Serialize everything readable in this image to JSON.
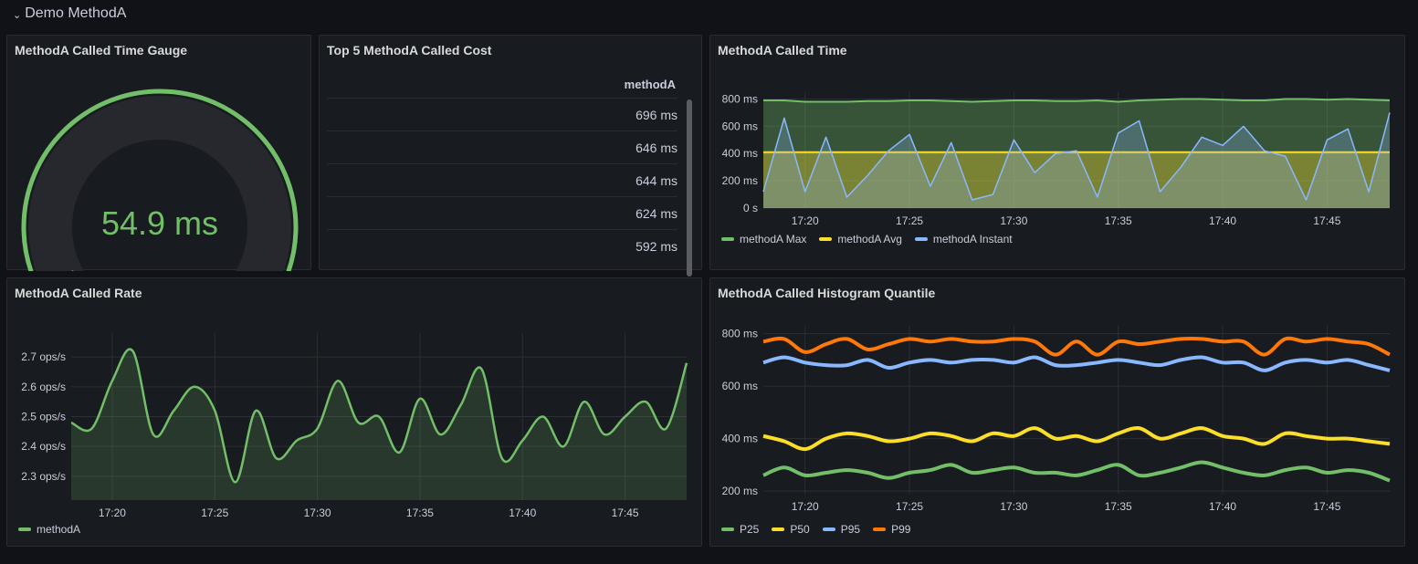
{
  "row": {
    "title": "Demo MethodA"
  },
  "colors": {
    "green": "#73bf69",
    "yellow": "#fade2a",
    "blue": "#8ab8ff",
    "orange": "#ff780a",
    "grid": "#2c2f35",
    "axis": "#ccccdc"
  },
  "gauge_panel": {
    "title": "MethodA Called Time Gauge",
    "value": "54.9 ms",
    "fraction": 0.069
  },
  "top5_panel": {
    "title": "Top 5 MethodA Called Cost",
    "column": "methodA",
    "rows": [
      "696 ms",
      "646 ms",
      "644 ms",
      "624 ms",
      "592 ms"
    ]
  },
  "time_panel": {
    "title": "MethodA Called Time",
    "legend": [
      {
        "label": "methodA Max",
        "color": "#73bf69"
      },
      {
        "label": "methodA Avg",
        "color": "#fade2a"
      },
      {
        "label": "methodA Instant",
        "color": "#8ab8ff"
      }
    ]
  },
  "rate_panel": {
    "title": "MethodA Called Rate",
    "legend": [
      {
        "label": "methodA",
        "color": "#73bf69"
      }
    ]
  },
  "hist_panel": {
    "title": "MethodA Called Histogram Quantile",
    "legend": [
      {
        "label": "P25",
        "color": "#73bf69"
      },
      {
        "label": "P50",
        "color": "#fade2a"
      },
      {
        "label": "P95",
        "color": "#8ab8ff"
      },
      {
        "label": "P99",
        "color": "#ff780a"
      }
    ]
  },
  "chart_data": [
    {
      "id": "time",
      "type": "area",
      "x": [
        "17:18",
        "17:19",
        "17:20",
        "17:21",
        "17:22",
        "17:23",
        "17:24",
        "17:25",
        "17:26",
        "17:27",
        "17:28",
        "17:29",
        "17:30",
        "17:31",
        "17:32",
        "17:33",
        "17:34",
        "17:35",
        "17:36",
        "17:37",
        "17:38",
        "17:39",
        "17:40",
        "17:41",
        "17:42",
        "17:43",
        "17:44",
        "17:45",
        "17:46",
        "17:47",
        "17:48"
      ],
      "xticks": [
        "17:20",
        "17:25",
        "17:30",
        "17:35",
        "17:40",
        "17:45"
      ],
      "yticks": [
        "0 s",
        "200 ms",
        "400 ms",
        "600 ms",
        "800 ms"
      ],
      "ylim": [
        0,
        850
      ],
      "series": [
        {
          "name": "methodA Max",
          "values": [
            790,
            790,
            780,
            780,
            780,
            785,
            785,
            790,
            790,
            785,
            780,
            785,
            790,
            790,
            785,
            785,
            790,
            780,
            790,
            795,
            800,
            800,
            795,
            790,
            790,
            800,
            800,
            795,
            800,
            795,
            790
          ]
        },
        {
          "name": "methodA Avg",
          "values": [
            410,
            410,
            410,
            410,
            410,
            410,
            410,
            410,
            410,
            410,
            410,
            410,
            410,
            410,
            410,
            410,
            410,
            410,
            410,
            410,
            410,
            410,
            410,
            410,
            410,
            410,
            410,
            410,
            410,
            410,
            410
          ]
        },
        {
          "name": "methodA Instant",
          "values": [
            120,
            660,
            120,
            520,
            80,
            240,
            420,
            540,
            160,
            480,
            60,
            100,
            500,
            260,
            400,
            420,
            80,
            550,
            640,
            120,
            300,
            520,
            460,
            600,
            420,
            380,
            60,
            500,
            580,
            120,
            700
          ]
        }
      ]
    },
    {
      "id": "rate",
      "type": "line",
      "x": [
        "17:18",
        "17:19",
        "17:20",
        "17:21",
        "17:22",
        "17:23",
        "17:24",
        "17:25",
        "17:26",
        "17:27",
        "17:28",
        "17:29",
        "17:30",
        "17:31",
        "17:32",
        "17:33",
        "17:34",
        "17:35",
        "17:36",
        "17:37",
        "17:38",
        "17:39",
        "17:40",
        "17:41",
        "17:42",
        "17:43",
        "17:44",
        "17:45",
        "17:46",
        "17:47",
        "17:48"
      ],
      "xticks": [
        "17:20",
        "17:25",
        "17:30",
        "17:35",
        "17:40",
        "17:45"
      ],
      "yticks": [
        "2.3 ops/s",
        "2.4 ops/s",
        "2.5 ops/s",
        "2.6 ops/s",
        "2.7 ops/s"
      ],
      "ylim": [
        2.22,
        2.78
      ],
      "series": [
        {
          "name": "methodA",
          "values": [
            2.48,
            2.46,
            2.62,
            2.72,
            2.44,
            2.52,
            2.6,
            2.52,
            2.28,
            2.52,
            2.36,
            2.42,
            2.46,
            2.62,
            2.48,
            2.5,
            2.38,
            2.56,
            2.44,
            2.54,
            2.66,
            2.36,
            2.42,
            2.5,
            2.4,
            2.55,
            2.44,
            2.5,
            2.55,
            2.46,
            2.68
          ]
        }
      ]
    },
    {
      "id": "hist",
      "type": "line",
      "x": [
        "17:18",
        "17:19",
        "17:20",
        "17:21",
        "17:22",
        "17:23",
        "17:24",
        "17:25",
        "17:26",
        "17:27",
        "17:28",
        "17:29",
        "17:30",
        "17:31",
        "17:32",
        "17:33",
        "17:34",
        "17:35",
        "17:36",
        "17:37",
        "17:38",
        "17:39",
        "17:40",
        "17:41",
        "17:42",
        "17:43",
        "17:44",
        "17:45",
        "17:46",
        "17:47",
        "17:48"
      ],
      "xticks": [
        "17:20",
        "17:25",
        "17:30",
        "17:35",
        "17:40",
        "17:45"
      ],
      "yticks": [
        "200 ms",
        "400 ms",
        "600 ms",
        "800 ms"
      ],
      "ylim": [
        190,
        830
      ],
      "series": [
        {
          "name": "P25",
          "values": [
            260,
            290,
            260,
            270,
            280,
            270,
            250,
            270,
            280,
            300,
            270,
            280,
            290,
            270,
            270,
            260,
            280,
            300,
            260,
            270,
            290,
            310,
            290,
            270,
            260,
            280,
            290,
            270,
            280,
            270,
            240
          ]
        },
        {
          "name": "P50",
          "values": [
            410,
            390,
            360,
            400,
            420,
            410,
            390,
            400,
            420,
            410,
            390,
            420,
            410,
            440,
            400,
            410,
            390,
            420,
            440,
            400,
            420,
            440,
            410,
            400,
            380,
            420,
            410,
            400,
            400,
            390,
            380
          ]
        },
        {
          "name": "P95",
          "values": [
            690,
            710,
            690,
            680,
            680,
            700,
            670,
            690,
            700,
            690,
            700,
            700,
            690,
            710,
            680,
            680,
            690,
            700,
            690,
            680,
            700,
            710,
            690,
            690,
            660,
            690,
            700,
            690,
            700,
            680,
            660
          ]
        },
        {
          "name": "P99",
          "values": [
            770,
            780,
            730,
            760,
            780,
            740,
            760,
            780,
            770,
            780,
            770,
            770,
            780,
            770,
            720,
            770,
            720,
            770,
            760,
            770,
            780,
            780,
            770,
            770,
            720,
            780,
            770,
            780,
            770,
            760,
            720
          ]
        }
      ]
    }
  ]
}
